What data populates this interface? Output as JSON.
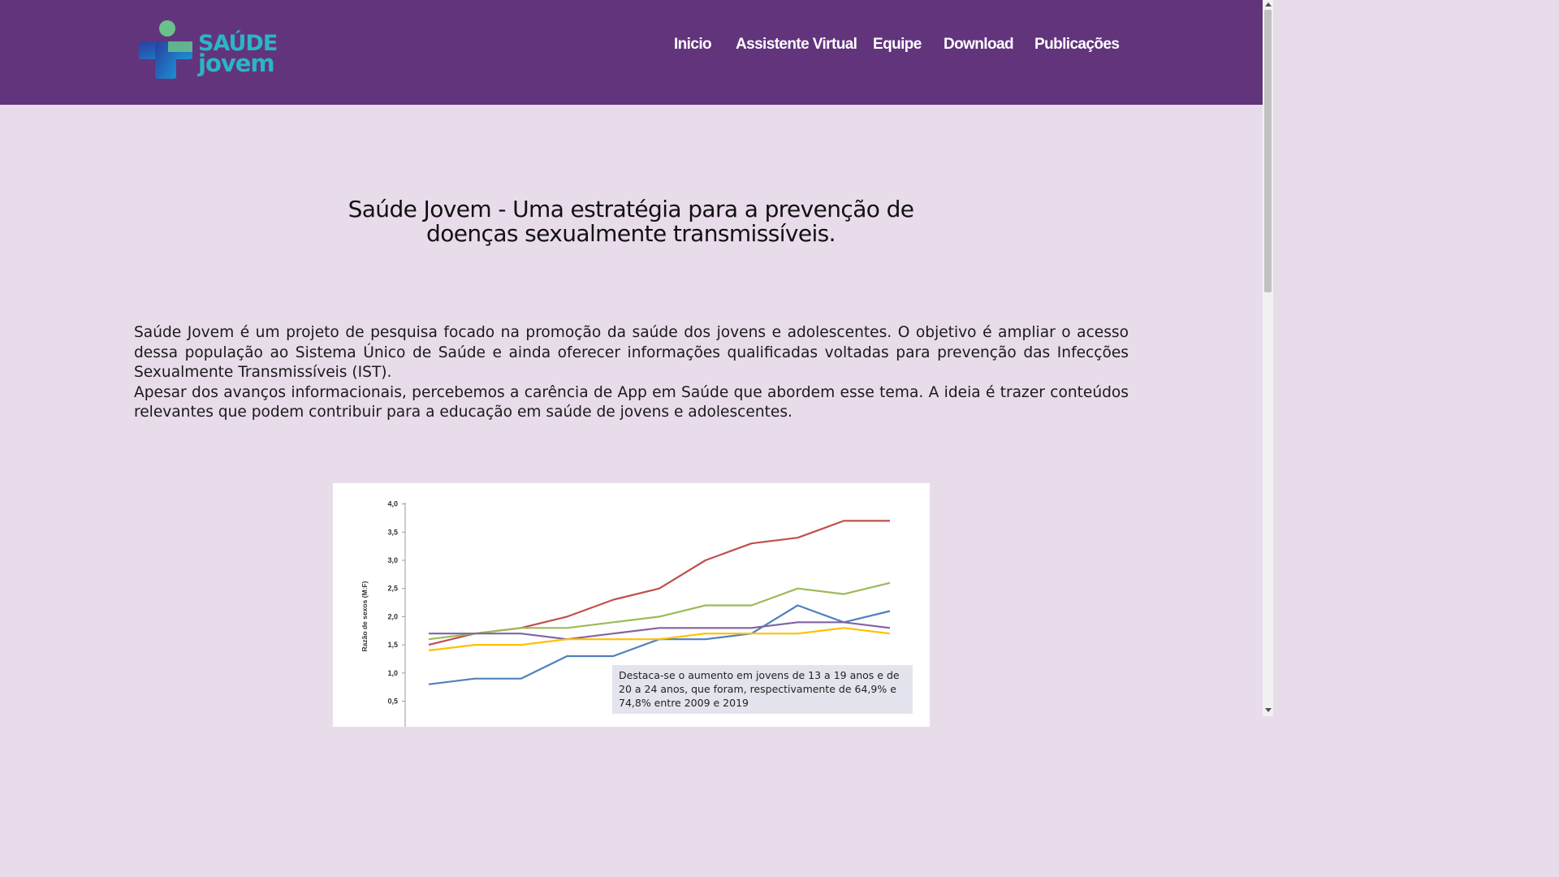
{
  "brand": {
    "logo_line1": "SAÚDE",
    "logo_line2": "jovem"
  },
  "nav": {
    "items": [
      {
        "label": "Inicio"
      },
      {
        "label": "Assistente Virtual"
      },
      {
        "label": "Equipe"
      },
      {
        "label": "Download"
      },
      {
        "label": "Publicações"
      }
    ]
  },
  "main": {
    "title": "Saúde Jovem - Uma estratégia para a prevenção de doenças sexualmente transmissíveis.",
    "paragraph1": "Saúde Jovem é um projeto de pesquisa focado na promoção da saúde dos jovens e adolescentes. O objetivo é ampliar o acesso dessa população ao Sistema Único de Saúde e ainda oferecer informações qualificadas voltadas para prevenção das Infecções Sexualmente Transmissíveis (IST).",
    "paragraph2": "Apesar dos avanços informacionais, percebemos a carência de App em Saúde que abordem esse tema. A ideia é trazer conteúdos relevantes que podem contribuir para a educação em saúde de jovens e adolescentes."
  },
  "colors": {
    "header_bg": "#62347c",
    "page_bg": "#e8dceb",
    "logo_teal": "#2bb5c6",
    "logo_blue": "#1f5fbf",
    "logo_green": "#6cc08b"
  },
  "chart_data": {
    "type": "line",
    "ylabel": "Razão de sexos (M:F)",
    "ylim": [
      0.5,
      4.0
    ],
    "yticks": [
      "0,5",
      "1,0",
      "1,5",
      "2,0",
      "2,5",
      "3,0",
      "3,5",
      "4,0"
    ],
    "x": [
      1,
      2,
      3,
      4,
      5,
      6,
      7,
      8,
      9,
      10,
      11
    ],
    "series": [
      {
        "color": "#c0504d",
        "values": [
          1.5,
          1.7,
          1.8,
          2.0,
          2.3,
          2.5,
          3.0,
          3.3,
          3.4,
          3.7,
          3.7
        ]
      },
      {
        "color": "#9bbb59",
        "values": [
          1.6,
          1.7,
          1.8,
          1.8,
          1.9,
          2.0,
          2.2,
          2.2,
          2.5,
          2.4,
          2.6
        ]
      },
      {
        "color": "#4f81bd",
        "values": [
          0.8,
          0.9,
          0.9,
          1.3,
          1.3,
          1.6,
          1.6,
          1.7,
          2.2,
          1.9,
          2.1
        ]
      },
      {
        "color": "#8064a2",
        "values": [
          1.7,
          1.7,
          1.7,
          1.6,
          1.7,
          1.8,
          1.8,
          1.8,
          1.9,
          1.9,
          1.8
        ]
      },
      {
        "color": "#ffc000",
        "values": [
          1.4,
          1.5,
          1.5,
          1.6,
          1.6,
          1.6,
          1.7,
          1.7,
          1.7,
          1.8,
          1.7
        ]
      }
    ],
    "annotation": "Destaca-se o aumento em jovens de 13 a 19 anos e de 20 a 24 anos, que foram, respectivamente de 64,9% e 74,8% entre 2009 e 2019"
  }
}
